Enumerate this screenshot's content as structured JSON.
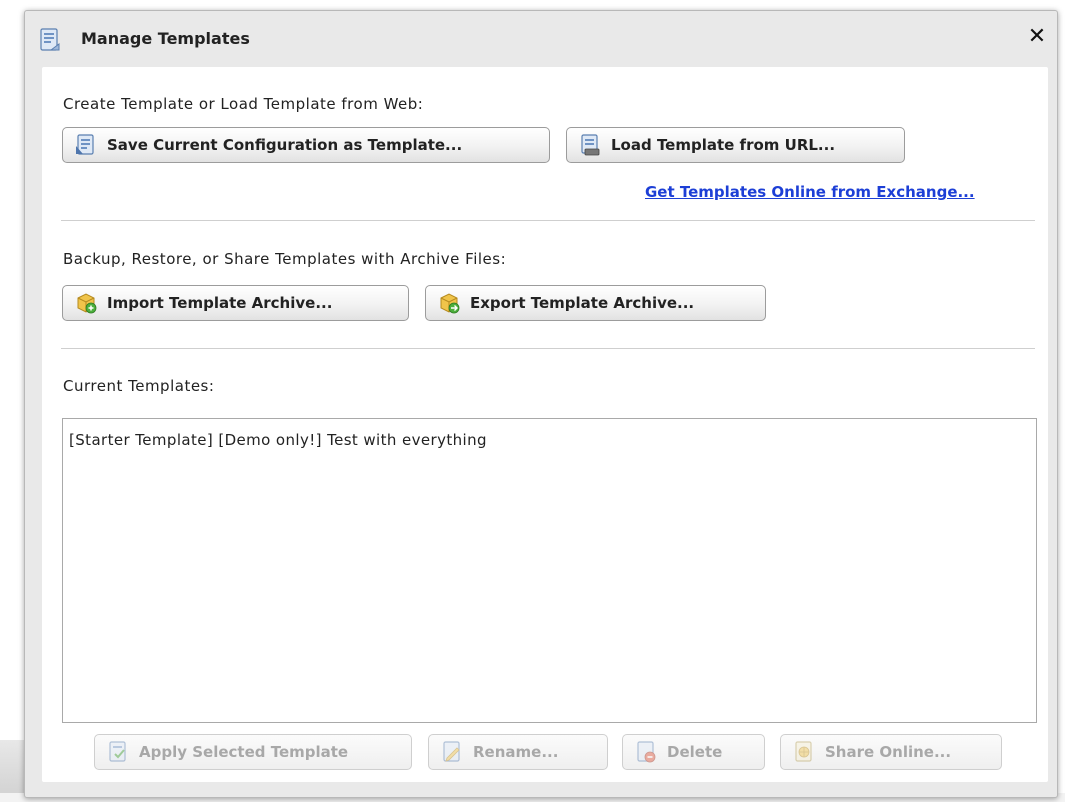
{
  "dialog": {
    "title": "Manage Templates",
    "close_label": "✕"
  },
  "create_section": {
    "label": "Create Template or Load Template from Web:",
    "save_button": "Save Current Configuration as Template...",
    "load_button": "Load Template from URL...",
    "exchange_link": "Get Templates Online from Exchange..."
  },
  "archive_section": {
    "label": "Backup, Restore, or Share Templates with Archive Files:",
    "import_button": "Import Template Archive...",
    "export_button": "Export Template Archive..."
  },
  "templates_section": {
    "label": "Current Templates:",
    "items": [
      "[Starter Template] [Demo only!] Test with everything"
    ]
  },
  "actions": {
    "apply": "Apply Selected Template",
    "rename": "Rename...",
    "delete": "Delete",
    "share": "Share Online..."
  },
  "colors": {
    "link": "#1d3fd6",
    "disabled_text": "#a8a8a8",
    "dialog_frame": "#e9e9e9"
  }
}
